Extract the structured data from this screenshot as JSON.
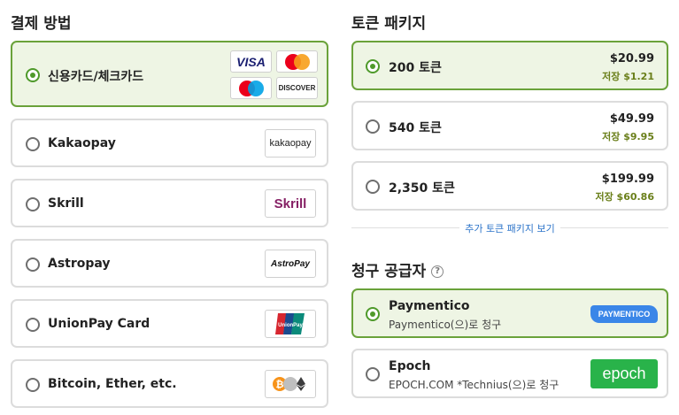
{
  "payment_method": {
    "title": "결제 방법",
    "options": [
      {
        "label": "신용카드/체크카드",
        "selected": true,
        "logos": [
          "VISA",
          "mastercard",
          "maestro",
          "DISCOVER"
        ]
      },
      {
        "label": "Kakaopay",
        "selected": false,
        "logo": "kakaopay"
      },
      {
        "label": "Skrill",
        "selected": false,
        "logo": "Skrill"
      },
      {
        "label": "Astropay",
        "selected": false,
        "logo": "AstroPay"
      },
      {
        "label": "UnionPay Card",
        "selected": false,
        "logo": "UnionPay"
      },
      {
        "label": "Bitcoin, Ether, etc.",
        "selected": false,
        "logo": "crypto"
      }
    ]
  },
  "token_packages": {
    "title": "토큰 패키지",
    "packages": [
      {
        "label": "200 토큰",
        "price": "$20.99",
        "saving": "저장 $1.21",
        "selected": true
      },
      {
        "label": "540 토큰",
        "price": "$49.99",
        "saving": "저장 $9.95",
        "selected": false
      },
      {
        "label": "2,350 토큰",
        "price": "$199.99",
        "saving": "저장 $60.86",
        "selected": false
      }
    ],
    "more_link": "추가 토큰 패키지 보기"
  },
  "billing_provider": {
    "title": "청구 공급자",
    "help_glyph": "?",
    "providers": [
      {
        "name": "Paymentico",
        "sub": "Paymentico(으)로 청구",
        "logo": "PAYMENTICO",
        "selected": true
      },
      {
        "name": "Epoch",
        "sub": "EPOCH.COM *Technius(으)로 청구",
        "logo": "epoch",
        "selected": false
      }
    ]
  },
  "colors": {
    "selected_border": "#6aa23a",
    "selected_bg": "#eef5e4",
    "radio_on": "#4f9a2b",
    "saving_text": "#6a7f1a",
    "link": "#2c74c9"
  }
}
